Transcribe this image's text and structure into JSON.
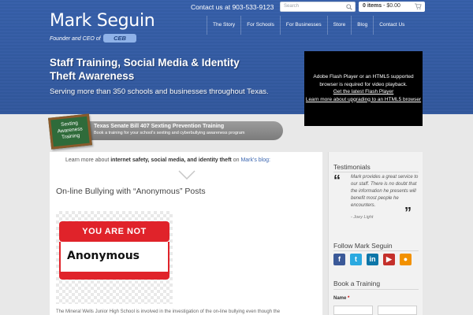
{
  "header": {
    "logo_name": "Mark Seguin",
    "logo_sub": "Founder and CEO of",
    "logo_badge": "CEB",
    "contact": "Contact us at 903-533-9123",
    "search_placeholder": "Search",
    "cart_count": "0 items",
    "cart_sep": " - ",
    "cart_total": "$0.00",
    "nav": [
      "The Story",
      "For Schools",
      "For Businesses",
      "Store",
      "Blog",
      "Contact Us"
    ],
    "headline": "Staff Training, Social Media & Identity Theft Awareness",
    "tagline": "Serving more than 350 schools and businesses throughout Texas.",
    "brand_color": "#3c66b4"
  },
  "flash": {
    "line1": "Adobe Flash Player or an HTML5 supported browser is required for video playback.",
    "link1": "Get the latest Flash Player",
    "link2": "Learn more about upgrading to an HTML5 browser"
  },
  "banner": {
    "badge": "Sexting Awareness Training",
    "title": "Texas Senate Bill 407 Sexting Prevention Training",
    "subtitle": "Book a training for your school's sexting and cyberbullying awareness program"
  },
  "main": {
    "learn_prefix": "Learn more about",
    "learn_strong": "internet safety, social media, and identity theft",
    "learn_on": "on",
    "learn_link": "Mark's blog:",
    "post_title": "On-line Bullying with “Anonymous” Posts",
    "image_top": "YOU ARE NOT",
    "image_scrawl": "Anonymous",
    "body_text": "The Mineral Wells Junior High School is involved in the investigation of the on-line bullying even though the"
  },
  "sidebar": {
    "testimonials_heading": "Testimonials",
    "quote": "Mark provides a great service to our staff. There is no doubt that the information he presents will benefit most people he encounters.",
    "quote_by": "- Joey Light",
    "follow_heading": "Follow Mark Seguin",
    "social": [
      {
        "name": "facebook-icon",
        "glyph": "f",
        "color": "#3b5998"
      },
      {
        "name": "twitter-icon",
        "glyph": "t",
        "color": "#2aa9e0"
      },
      {
        "name": "linkedin-icon",
        "glyph": "in",
        "color": "#0e76a8"
      },
      {
        "name": "youtube-icon",
        "glyph": "▶",
        "color": "#c4302b"
      },
      {
        "name": "rss-icon",
        "glyph": "●",
        "color": "#f29100"
      }
    ],
    "book_heading": "Book a Training",
    "name_label": "Name",
    "name_req": "*"
  }
}
